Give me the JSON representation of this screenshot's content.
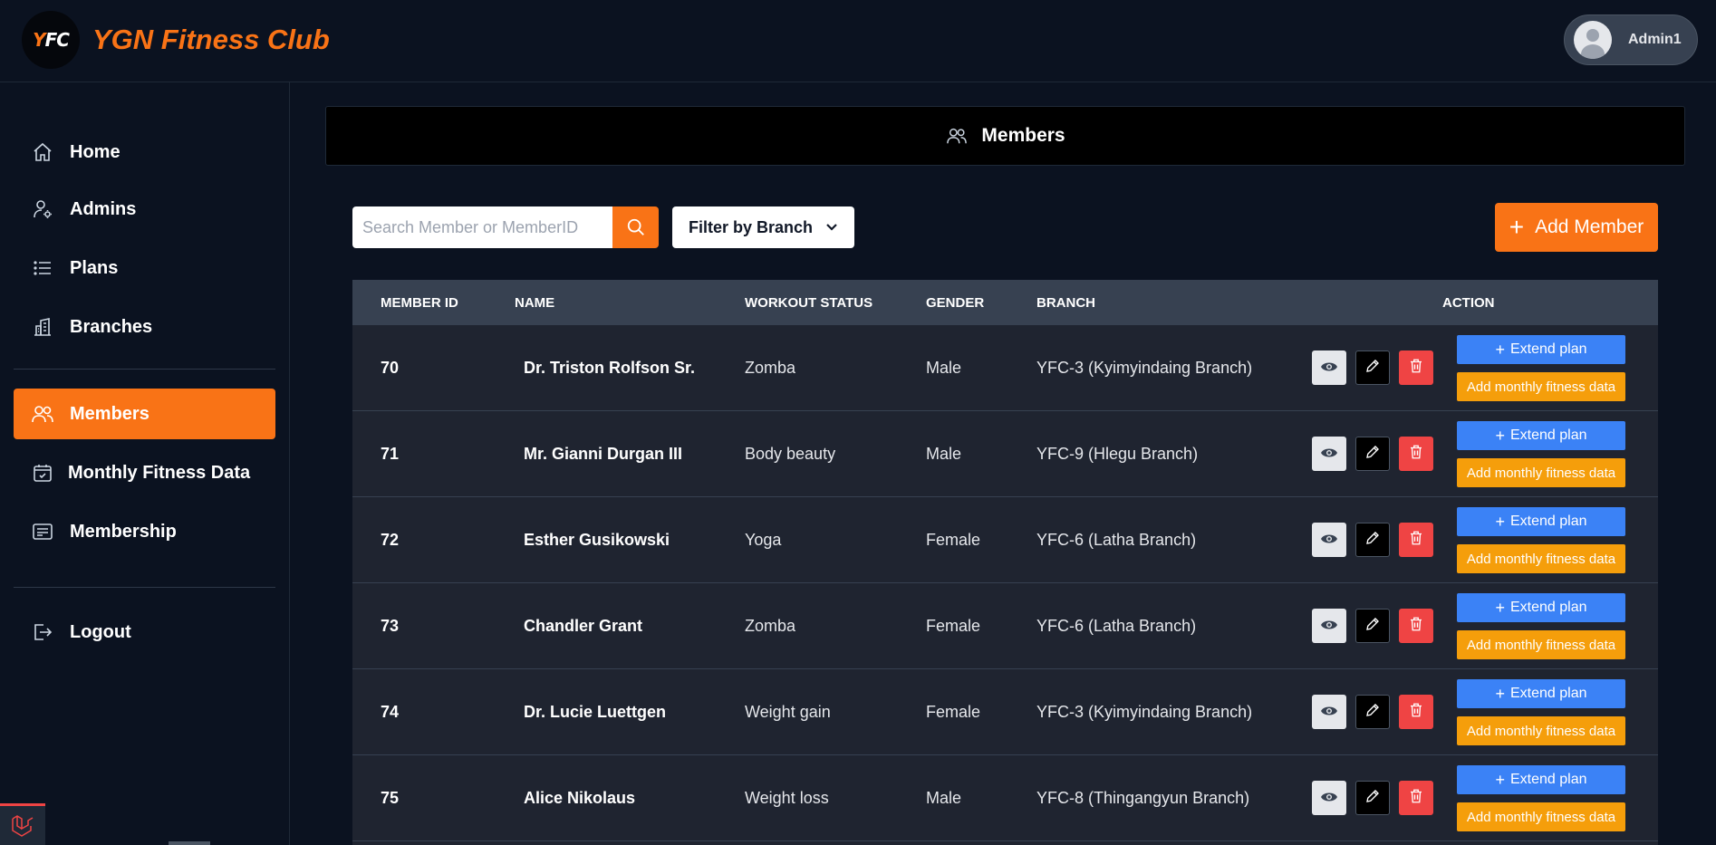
{
  "app": {
    "logo_text": "FC",
    "title": "YGN Fitness Club",
    "user_name": "Admin1"
  },
  "sidebar": {
    "items": [
      {
        "label": "Home",
        "icon": "home-icon"
      },
      {
        "label": "Admins",
        "icon": "user-gear-icon"
      },
      {
        "label": "Plans",
        "icon": "list-icon"
      },
      {
        "label": "Branches",
        "icon": "buildings-icon"
      },
      {
        "label": "Members",
        "icon": "users-icon",
        "active": true
      },
      {
        "label": "Monthly Fitness Data",
        "icon": "calendar-check-icon"
      },
      {
        "label": "Membership",
        "icon": "id-card-icon"
      },
      {
        "label": "Logout",
        "icon": "logout-icon"
      }
    ]
  },
  "page": {
    "title": "Members",
    "search_placeholder": "Search Member or MemberID",
    "filter_label": "Filter by Branch",
    "add_label": "Add Member"
  },
  "table": {
    "headers": [
      "MEMBER ID",
      "NAME",
      "WORKOUT STATUS",
      "GENDER",
      "BRANCH",
      "ACTION"
    ],
    "extend_label": "Extend plan",
    "fitness_label": "Add monthly fitness data",
    "rows": [
      {
        "id": "70",
        "name": "Dr. Triston Rolfson Sr.",
        "workout": "Zomba",
        "gender": "Male",
        "branch": "YFC-3 (Kyimyindaing Branch)"
      },
      {
        "id": "71",
        "name": "Mr. Gianni Durgan III",
        "workout": "Body beauty",
        "gender": "Male",
        "branch": "YFC-9 (Hlegu Branch)"
      },
      {
        "id": "72",
        "name": "Esther Gusikowski",
        "workout": "Yoga",
        "gender": "Female",
        "branch": "YFC-6 (Latha Branch)"
      },
      {
        "id": "73",
        "name": "Chandler Grant",
        "workout": "Zomba",
        "gender": "Female",
        "branch": "YFC-6 (Latha Branch)"
      },
      {
        "id": "74",
        "name": "Dr. Lucie Luettgen",
        "workout": "Weight gain",
        "gender": "Female",
        "branch": "YFC-3 (Kyimyindaing Branch)"
      },
      {
        "id": "75",
        "name": "Alice Nikolaus",
        "workout": "Weight loss",
        "gender": "Male",
        "branch": "YFC-8 (Thingangyun Branch)"
      }
    ]
  },
  "colors": {
    "accent": "#f97316",
    "background": "#0b1220",
    "extend": "#3b82f6",
    "fitness": "#f59e0b",
    "delete": "#ef4444"
  }
}
